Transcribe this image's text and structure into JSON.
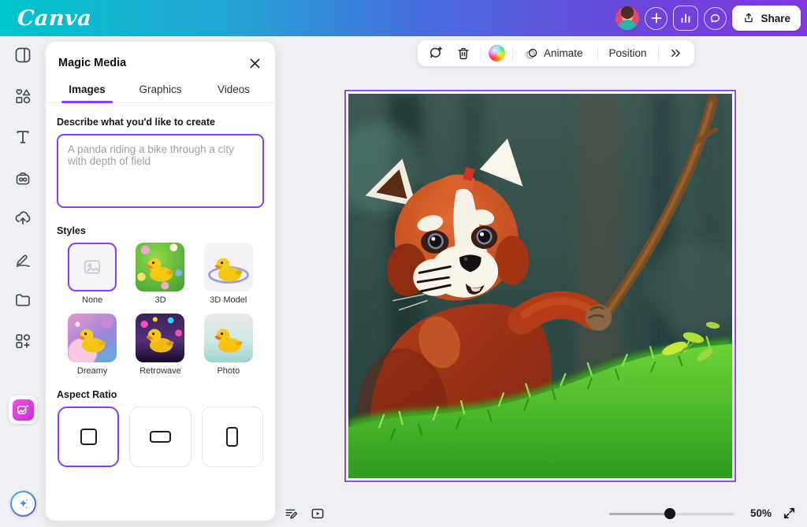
{
  "colors": {
    "accent": "#8b3dff",
    "magic_pink": "#d934d9",
    "header_gradient_start": "#00c4cc",
    "header_gradient_end": "#8038dd",
    "selection_border": "#8a4de8"
  },
  "header": {
    "logo_text": "Canva",
    "share_label": "Share",
    "icons": [
      "avatar",
      "add-member-icon",
      "insights-chart-icon",
      "comments-icon",
      "share-upload-icon"
    ]
  },
  "sidebar": {
    "items": [
      {
        "icon": "design-icon"
      },
      {
        "icon": "elements-icon"
      },
      {
        "icon": "text-icon"
      },
      {
        "icon": "brand-icon"
      },
      {
        "icon": "uploads-icon"
      },
      {
        "icon": "draw-icon"
      },
      {
        "icon": "projects-icon"
      },
      {
        "icon": "apps-icon"
      }
    ],
    "active_app_icon": "magic-media-icon",
    "assistant_icon": "sparkle-icon"
  },
  "panel": {
    "title": "Magic Media",
    "close_icon": "close-icon",
    "tabs": [
      {
        "label": "Images",
        "active": true
      },
      {
        "label": "Graphics",
        "active": false
      },
      {
        "label": "Videos",
        "active": false
      }
    ],
    "prompt": {
      "label": "Describe what you'd like to create",
      "placeholder": "A panda riding a bike through a city with depth of field",
      "value": ""
    },
    "styles": {
      "label": "Styles",
      "options": [
        {
          "label": "None",
          "selected": true
        },
        {
          "label": "3D",
          "selected": false
        },
        {
          "label": "3D Model",
          "selected": false
        },
        {
          "label": "Dreamy",
          "selected": false
        },
        {
          "label": "Retrowave",
          "selected": false
        },
        {
          "label": "Photo",
          "selected": false
        }
      ]
    },
    "aspect_ratio": {
      "label": "Aspect Ratio",
      "options": [
        {
          "name": "square",
          "selected": true
        },
        {
          "name": "landscape",
          "selected": false
        },
        {
          "name": "portrait",
          "selected": false
        }
      ]
    }
  },
  "toolbar": {
    "icons": [
      "add-comment-icon",
      "delete-icon",
      "color-wheel-icon",
      "animate-icon",
      "more-icon"
    ],
    "animate_label": "Animate",
    "position_label": "Position"
  },
  "canvas": {
    "image_alt": "AI-generated image of a red panda holding a wooden stick on bright green grass in a blurred forest"
  },
  "footer": {
    "zoom_level": "50%",
    "icons": [
      "notes-icon",
      "present-icon",
      "fullscreen-icon"
    ]
  }
}
